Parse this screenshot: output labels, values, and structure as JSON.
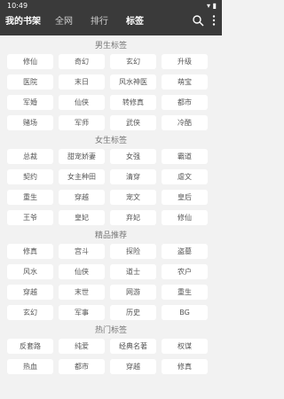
{
  "status": {
    "time": "10:49"
  },
  "nav": {
    "tabs": [
      "我的书架",
      "全网",
      "排行",
      "标签"
    ]
  },
  "sections": [
    {
      "title": "男生标签",
      "tags": [
        "修仙",
        "奇幻",
        "玄幻",
        "升级",
        "医院",
        "末日",
        "风水神医",
        "萌宝",
        "军婚",
        "仙侠",
        "转修真",
        "都市",
        "赌场",
        "军师",
        "武侠",
        "冷酷"
      ]
    },
    {
      "title": "女生标签",
      "tags": [
        "总裁",
        "甜宠娇妻",
        "女强",
        "霸道",
        "契约",
        "女主种田",
        "清穿",
        "虐文",
        "重生",
        "穿越",
        "宠文",
        "皇后",
        "王爷",
        "皇妃",
        "弃妃",
        "修仙"
      ]
    },
    {
      "title": "精品推荐",
      "tags": [
        "修真",
        "宫斗",
        "探险",
        "盗墓",
        "风水",
        "仙侠",
        "道士",
        "农户",
        "穿越",
        "末世",
        "网游",
        "重生",
        "玄幻",
        "军事",
        "历史",
        "BG"
      ]
    },
    {
      "title": "热门标签",
      "tags": [
        "反套路",
        "纯爱",
        "经典名著",
        "权谋",
        "热血",
        "都市",
        "穿越",
        "修真"
      ]
    }
  ]
}
